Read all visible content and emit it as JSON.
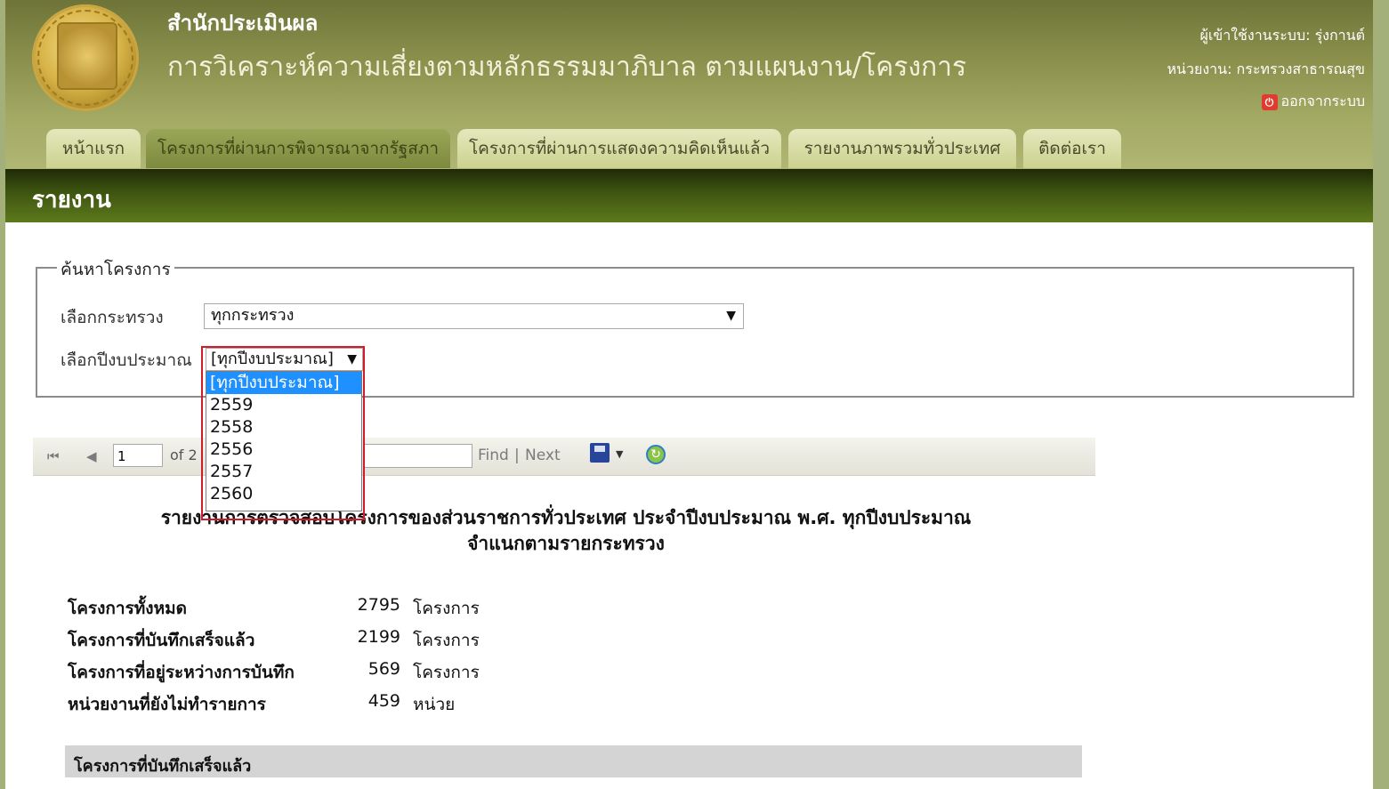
{
  "header": {
    "site_title": "สำนักประเมินผล",
    "site_subtitle": "การวิเคราะห์ความเสี่ยงตามหลักธรรมมาภิบาล ตามแผนงาน/โครงการ",
    "user_line": "ผู้เข้าใช้งานระบบ: รุ่งกานต์",
    "agency_line": "หน่วยงาน: กระทรวงสาธารณสุข",
    "logout_label": "ออกจากระบบ"
  },
  "nav": {
    "tabs": [
      {
        "label": "หน้าแรก"
      },
      {
        "label": "โครงการที่ผ่านการพิจารณาจากรัฐสภา"
      },
      {
        "label": "โครงการที่ผ่านการแสดงความคิดเห็นแล้ว"
      },
      {
        "label": "รายงานภาพรวมทั่วประเทศ"
      },
      {
        "label": "ติดต่อเรา"
      }
    ],
    "active_index": 1
  },
  "banner": {
    "title": "รายงาน"
  },
  "search": {
    "legend": "ค้นหาโครงการ",
    "ministry_label": "เลือกกระทรวง",
    "ministry_value": "ทุกกระทรวง",
    "year_label": "เลือกปีงบประมาณ",
    "year_value": "[ทุกปีงบประมาณ]",
    "year_options": [
      "[ทุกปีงบประมาณ]",
      "2559",
      "2558",
      "2556",
      "2557",
      "2560"
    ],
    "year_selected_index": 0
  },
  "toolbar": {
    "page_number": "1",
    "of_text": "of 2",
    "find_label": "Find",
    "separator": "|",
    "next_label": "Next"
  },
  "report": {
    "title_line1": "รายงานการตรวจสอบโครงการของส่วนราชการทั่วประเทศ ประจำปีงบประมาณ พ.ศ. ทุกปีงบประมาณ",
    "title_line2": "จำแนกตามรายกระทรวง",
    "stats": [
      {
        "label": "โครงการทั้งหมด",
        "value": "2795",
        "unit": "โครงการ"
      },
      {
        "label": "โครงการที่บันทึกเสร็จแล้ว",
        "value": "2199",
        "unit": "โครงการ"
      },
      {
        "label": "โครงการที่อยู่ระหว่างการบันทึก",
        "value": "569",
        "unit": "โครงการ"
      },
      {
        "label": "หน่วยงานที่ยังไม่ทำรายการ",
        "value": "459",
        "unit": "หน่วย"
      }
    ],
    "section_title": "โครงการที่บันทึกเสร็จแล้ว"
  }
}
